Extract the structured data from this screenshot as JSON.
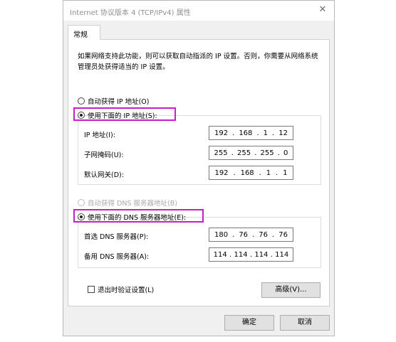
{
  "window": {
    "title": "Internet 协议版本 4 (TCP/IPv4) 属性",
    "close_symbol": "✕"
  },
  "tabs": [
    {
      "label": "常规",
      "active": true
    }
  ],
  "description": "如果网络支持此功能，则可以获取自动指派的 IP 设置。否则，你需要从网络系统管理员处获得适当的 IP 设置。",
  "ip_section": {
    "auto_label": "自动获得 IP 地址(O)",
    "manual_label": "使用下面的 IP 地址(S):",
    "selected": "manual",
    "fields": [
      {
        "label": "IP 地址(I):",
        "octets": [
          "192",
          "168",
          "1",
          "12"
        ]
      },
      {
        "label": "子网掩码(U):",
        "octets": [
          "255",
          "255",
          "255",
          "0"
        ]
      },
      {
        "label": "默认网关(D):",
        "octets": [
          "192",
          "168",
          "1",
          "1"
        ]
      }
    ]
  },
  "dns_section": {
    "auto_label": "自动获得 DNS 服务器地址(B)",
    "manual_label": "使用下面的 DNS 服务器地址(E):",
    "selected": "manual",
    "fields": [
      {
        "label": "首选 DNS 服务器(P):",
        "octets": [
          "180",
          "76",
          "76",
          "76"
        ]
      },
      {
        "label": "备用 DNS 服务器(A):",
        "octets": [
          "114",
          "114",
          "114",
          "114"
        ]
      }
    ]
  },
  "validate_label": "退出时验证设置(L)",
  "validate_checked": false,
  "advanced_button": "高级(V)...",
  "ok_button": "确定",
  "cancel_button": "取消",
  "colors": {
    "highlight": "#c81ec8",
    "window_bg": "#f0f0f0",
    "panel_bg": "#ffffff"
  }
}
